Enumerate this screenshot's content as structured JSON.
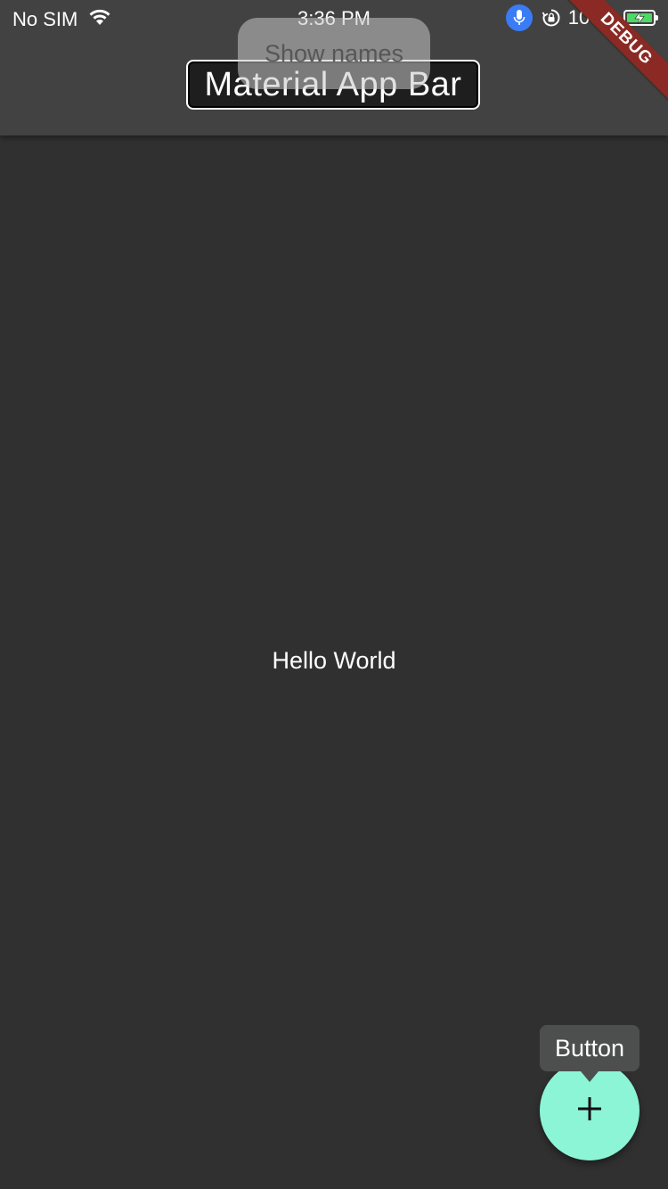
{
  "status_bar": {
    "carrier": "No SIM",
    "time": "3:36 PM",
    "battery_percent": "100%",
    "battery_level": 1.0,
    "icons": [
      "wifi-icon",
      "microphone-icon",
      "rotation-lock-icon",
      "battery-charging-icon"
    ]
  },
  "app_bar": {
    "title": "Material App Bar",
    "overlay_label": "Show names"
  },
  "debug_banner": {
    "label": "DEBUG"
  },
  "body": {
    "text": "Hello World"
  },
  "fab": {
    "icon": "plus-icon",
    "tooltip": "Button"
  },
  "colors": {
    "background": "#303030",
    "app_bar": "#424242",
    "fab": "#8cf5d6",
    "debug_banner": "#8b2a24",
    "mic_accent": "#3a7bf6",
    "battery_fill": "#4cd964"
  }
}
